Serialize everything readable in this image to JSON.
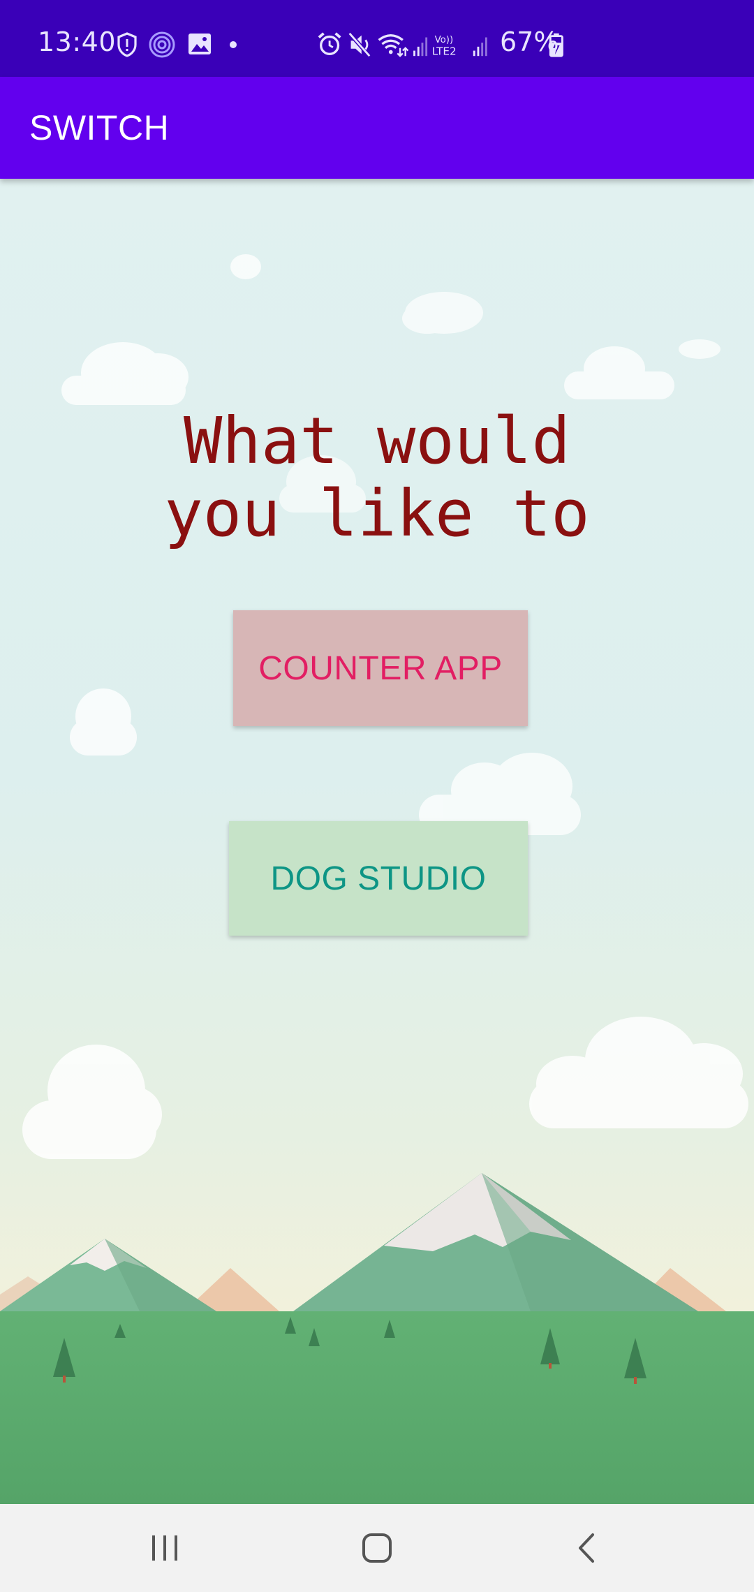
{
  "status_bar": {
    "time": "13:40",
    "battery": "67%",
    "left_icons": [
      "shield-icon",
      "hotspot-icon",
      "image-icon",
      "dot-icon"
    ],
    "right_icons": [
      "alarm-icon",
      "mute-icon",
      "wifi-icon",
      "signal-icon",
      "volte-lte2-icon",
      "signal-icon",
      "battery-charging-icon"
    ],
    "volte_label_top": "Vo))",
    "volte_label_bottom": "LTE2"
  },
  "app_bar": {
    "title": "SWITCH"
  },
  "main": {
    "headline_line1": "What would",
    "headline_line2": "you like to",
    "counter_button": "COUNTER APP",
    "dog_button": "DOG STUDIO"
  },
  "nav_bar": {
    "items": [
      "recent-apps-icon",
      "home-icon",
      "back-icon"
    ]
  },
  "colors": {
    "status_bar": "#3a00b8",
    "app_bar": "#6200ee",
    "headline": "#8a1010",
    "counter_bg": "#d7b6b6",
    "counter_text": "#e21e63",
    "dog_bg": "#c6e3c8",
    "dog_text": "#0d9585",
    "grass": "#5aa76a",
    "nav_bar": "#f2f2f2"
  }
}
